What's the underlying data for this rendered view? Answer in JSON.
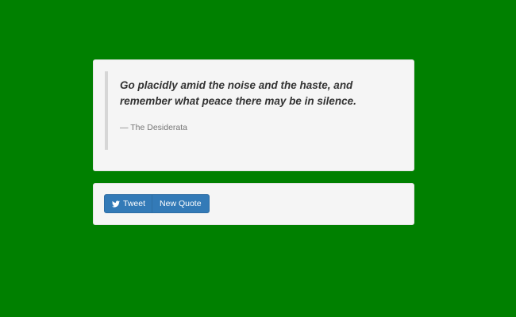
{
  "page": {
    "background_color": "#008000"
  },
  "quote": {
    "text": "Go placidly amid the noise and the haste, and remember what peace there may be in silence.",
    "author": "— The Desiderata"
  },
  "actions": {
    "tweet_label": "Tweet",
    "tweet_icon": "twitter-icon",
    "new_quote_label": "New Quote",
    "button_color": "#337ab7"
  }
}
